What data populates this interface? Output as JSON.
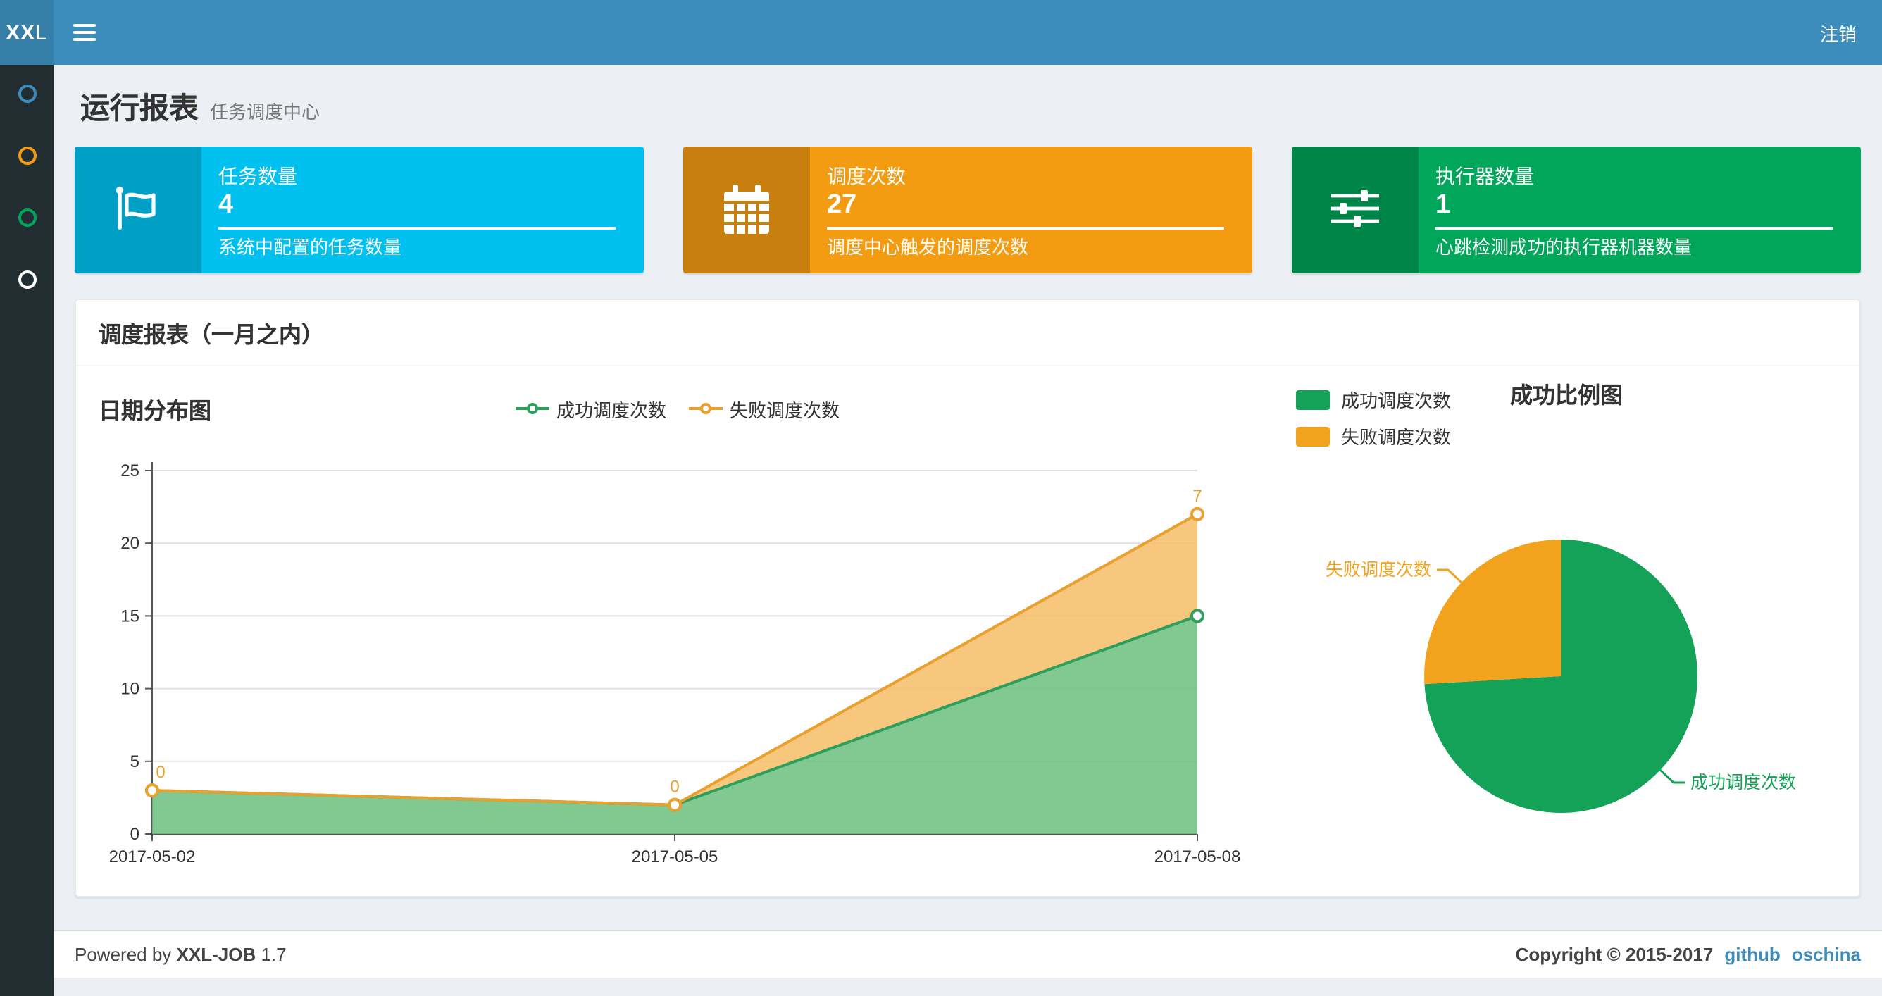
{
  "palette": {
    "navbar": "#3c8dbc",
    "logo_bg": "#367fa9",
    "sidebar_bg": "#222d32",
    "link_blue": "#3c8dbc"
  },
  "navbar": {
    "logo_bold": "XX",
    "logo_light": "L",
    "logout_label": "注销"
  },
  "sidebar": {
    "items": [
      {
        "name": "menu-item-1",
        "color": "#3c8dbc"
      },
      {
        "name": "menu-item-2",
        "color": "#f39c12"
      },
      {
        "name": "menu-item-3",
        "color": "#00a65a"
      },
      {
        "name": "menu-item-4",
        "color": "#ffffff"
      }
    ]
  },
  "page_header": {
    "title": "运行报表",
    "subtitle": "任务调度中心"
  },
  "info_boxes": [
    {
      "label": "任务数量",
      "value": "4",
      "description": "系统中配置的任务数量",
      "color": "#00c0ef",
      "icon_bg": "#009fc6",
      "icon": "flag-icon"
    },
    {
      "label": "调度次数",
      "value": "27",
      "description": "调度中心触发的调度次数",
      "color": "#f39c12",
      "icon_bg": "#c87f0e",
      "icon": "calendar-icon"
    },
    {
      "label": "执行器数量",
      "value": "1",
      "description": "心跳检测成功的执行器机器数量",
      "color": "#00a65a",
      "icon_bg": "#008549",
      "icon": "sliders-icon"
    }
  ],
  "panel": {
    "title": "调度报表（一月之内）"
  },
  "chart_data": [
    {
      "type": "area",
      "title": "日期分布图",
      "stacked": true,
      "categories": [
        "2017-05-02",
        "2017-05-05",
        "2017-05-08"
      ],
      "series": [
        {
          "name": "成功调度次数",
          "values": [
            3,
            2,
            15
          ],
          "color": "#2d9e5b",
          "fill": "rgba(108,190,126,0.85)",
          "show_labels": false
        },
        {
          "name": "失败调度次数",
          "values": [
            0,
            0,
            7
          ],
          "color": "#e9a02e",
          "fill": "rgba(245,189,102,0.85)",
          "show_labels": true
        }
      ],
      "ylim": [
        0,
        25
      ],
      "ytick_step": 5,
      "grid": true,
      "legend_position": "top-center"
    },
    {
      "type": "pie",
      "title": "成功比例图",
      "slices": [
        {
          "name": "成功调度次数",
          "value": 20,
          "color": "#13a258"
        },
        {
          "name": "失败调度次数",
          "value": 7,
          "color": "#f2a21c"
        }
      ],
      "legend_position": "top-left"
    }
  ],
  "footer": {
    "powered_prefix": "Powered by",
    "product": "XXL-JOB",
    "version": "1.7",
    "copyright": "Copyright © 2015-2017",
    "links": [
      {
        "label": "github"
      },
      {
        "label": "oschina"
      }
    ]
  }
}
